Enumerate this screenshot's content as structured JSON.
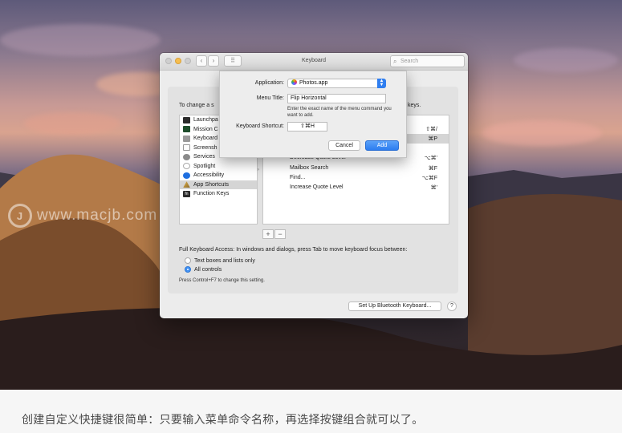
{
  "watermark": {
    "logo_text": "J",
    "text": "www.macjb.com"
  },
  "window": {
    "title": "Keyboard",
    "search_placeholder": "Search",
    "nav_back": "‹",
    "nav_forward": "›",
    "grid_icon": "⠿",
    "instruction_left": "To change a s",
    "instruction_right": "keys.",
    "categories": [
      {
        "label": "Launchpa",
        "icon": "launchpad-icon",
        "color": "#2b2b2b"
      },
      {
        "label": "Mission C",
        "icon": "mission-control-icon",
        "color": "#1e4d2b"
      },
      {
        "label": "Keyboard",
        "icon": "keyboard-icon",
        "color": "#8a8a8a"
      },
      {
        "label": "Screensh",
        "icon": "screenshot-icon",
        "color": "#6b6b6b"
      },
      {
        "label": "Services",
        "icon": "services-icon",
        "color": "#7b7b7b"
      },
      {
        "label": "Spotlight",
        "icon": "spotlight-icon",
        "color": "#9a9a9a"
      },
      {
        "label": "Accessibility",
        "icon": "accessibility-icon",
        "color": "#1f6fe0"
      },
      {
        "label": "App Shortcuts",
        "icon": "app-shortcuts-icon",
        "color": "#c9a13a",
        "selected": true
      },
      {
        "label": "Function Keys",
        "icon": "function-keys-icon",
        "color": "#2b2b2b",
        "icon_text": "fn"
      }
    ],
    "shortcuts_visible_keys_top": [
      "⇧⌘/",
      "⌘P"
    ],
    "shortcuts": [
      {
        "label": "Decrease Quote Level",
        "key": "⌥⌘'"
      },
      {
        "label": "Mailbox Search",
        "key": "⌘F"
      },
      {
        "label": "Find...",
        "key": "⌥⌘F"
      },
      {
        "label": "Increase Quote Level",
        "key": "⌘'"
      }
    ],
    "add_button": "+",
    "remove_button": "−",
    "full_keyboard_access": "Full Keyboard Access: In windows and dialogs, press Tab to move keyboard focus between:",
    "radio_options": [
      {
        "label": "Text boxes and lists only",
        "selected": false
      },
      {
        "label": "All controls",
        "selected": true
      }
    ],
    "note": "Press Control+F7 to change this setting.",
    "bluetooth_button": "Set Up Bluetooth Keyboard...",
    "help_button": "?"
  },
  "sheet": {
    "application_label": "Application:",
    "application_value": "Photos.app",
    "menu_title_label": "Menu Title:",
    "menu_title_value": "Flip Horizontal",
    "hint": "Enter the exact name of the menu command you want to add.",
    "shortcut_label": "Keyboard Shortcut:",
    "shortcut_value": "⇧⌘H",
    "cancel": "Cancel",
    "add": "Add"
  },
  "caption": "创建自定义快捷键很简单：只要输入菜单命令名称，再选择按键组合就可以了。"
}
